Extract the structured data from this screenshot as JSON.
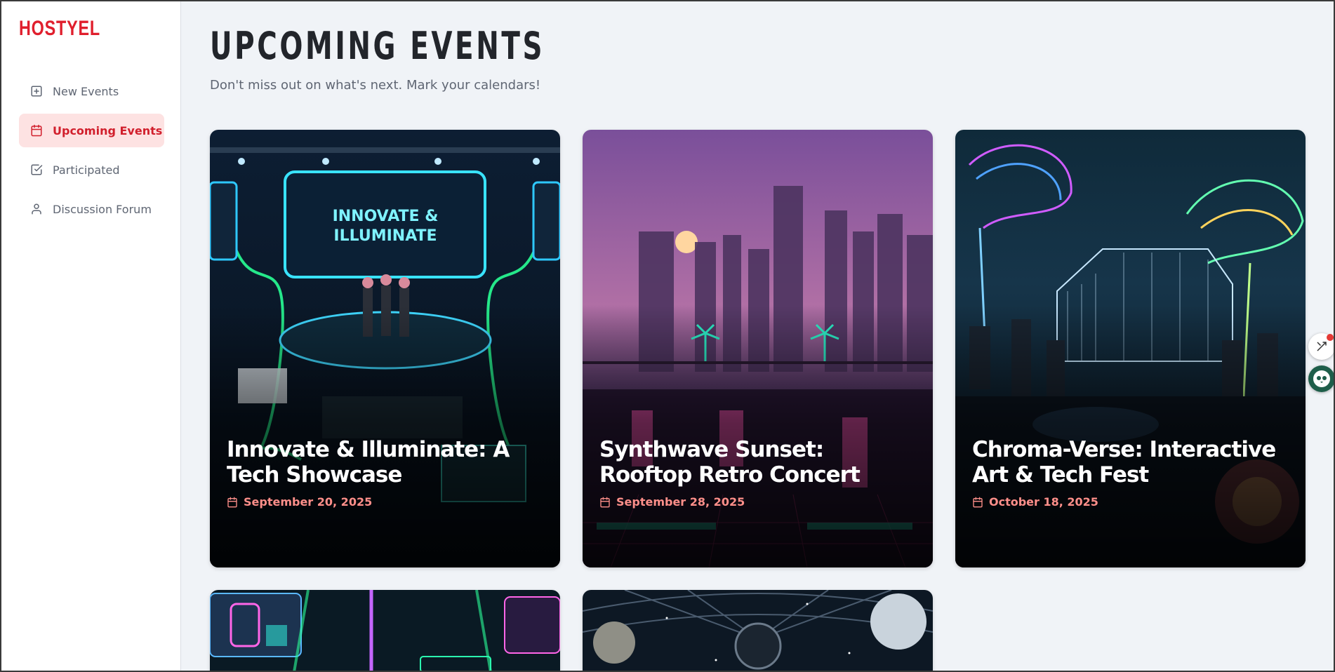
{
  "app": {
    "logo": "HOSTYEL"
  },
  "sidebar": {
    "items": [
      {
        "label": "New Events",
        "icon": "plus-square-icon",
        "active": false
      },
      {
        "label": "Upcoming Events",
        "icon": "calendar-icon",
        "active": true
      },
      {
        "label": "Participated",
        "icon": "check-square-icon",
        "active": false
      },
      {
        "label": "Discussion Forum",
        "icon": "user-icon",
        "active": false
      }
    ]
  },
  "main": {
    "title": "UPCOMING EVENTS",
    "subtitle": "Don't miss out on what's next. Mark your calendars!",
    "events": [
      {
        "title": "Innovate & Illuminate: A Tech Showcase",
        "date": "September 20, 2025"
      },
      {
        "title": "Synthwave Sunset: Rooftop Retro Concert",
        "date": "September 28, 2025"
      },
      {
        "title": "Chroma-Verse: Interactive Art & Tech Fest",
        "date": "October 18, 2025"
      },
      {
        "title": "",
        "date": ""
      },
      {
        "title": "",
        "date": ""
      }
    ]
  },
  "colors": {
    "accent": "#e01f2d",
    "active_bg": "#fde2e2",
    "date_text": "#ff8f8a",
    "page_bg": "#f0f3f7"
  }
}
